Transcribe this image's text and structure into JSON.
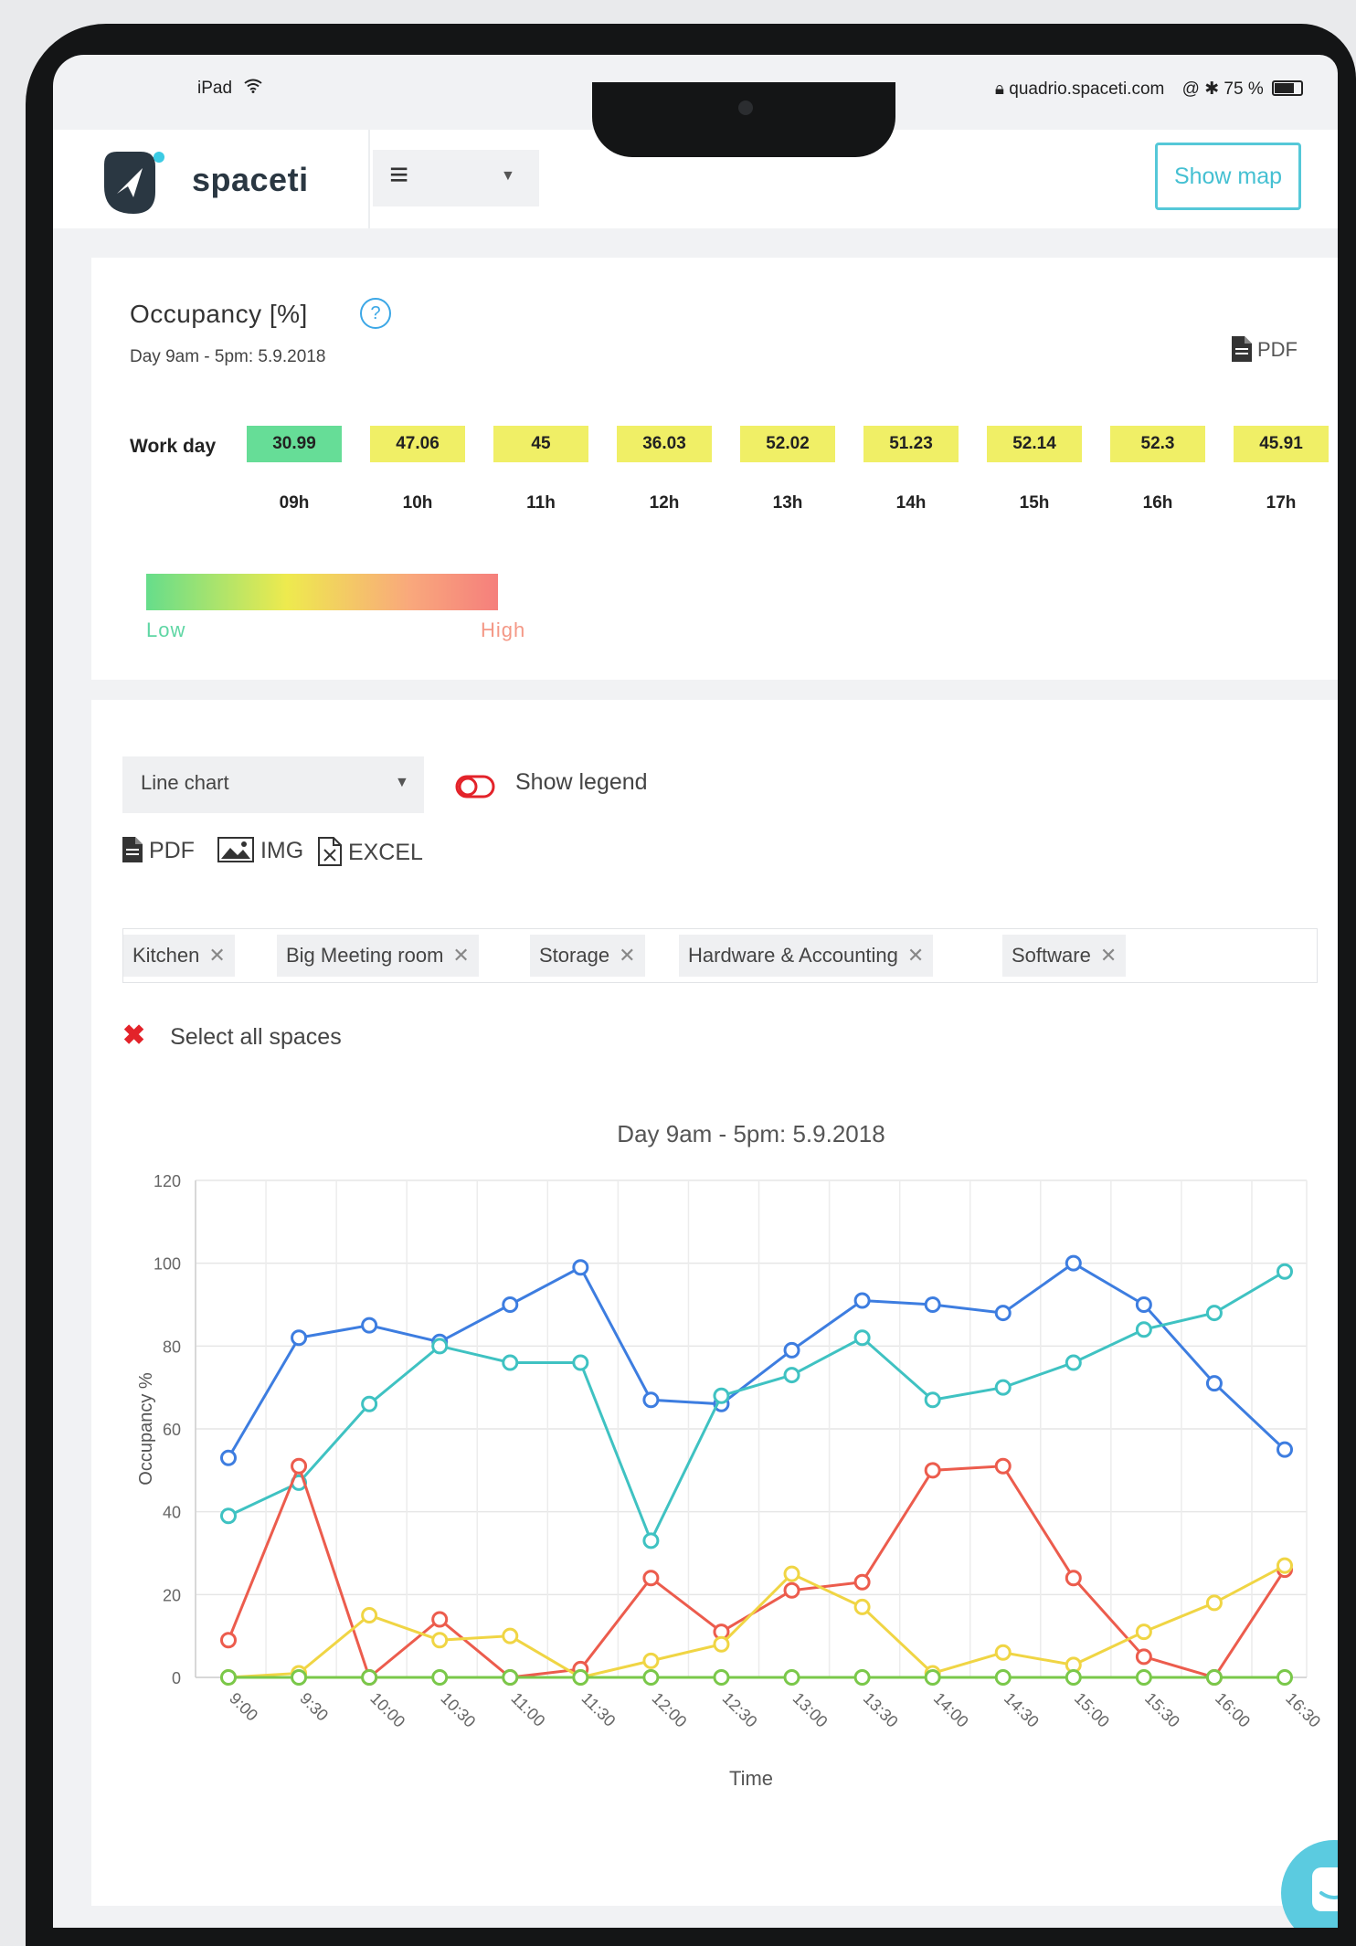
{
  "status_bar": {
    "device": "iPad",
    "url": "quadrio.spaceti.com",
    "battery": "75 %"
  },
  "header": {
    "logo_text": "spaceti",
    "menu_icon": "hamburger-icon",
    "show_map_label": "Show map"
  },
  "occupancy": {
    "title": "Occupancy [%]",
    "subtitle": "Day 9am - 5pm: 5.9.2018",
    "pdf_label": "PDF",
    "row_label": "Work day",
    "cells": [
      {
        "hour": "09h",
        "value": "30.99",
        "color": "#66dd97"
      },
      {
        "hour": "10h",
        "value": "47.06",
        "color": "#f0ef66"
      },
      {
        "hour": "11h",
        "value": "45",
        "color": "#f0ef66"
      },
      {
        "hour": "12h",
        "value": "36.03",
        "color": "#f0ef66"
      },
      {
        "hour": "13h",
        "value": "52.02",
        "color": "#f0ef66"
      },
      {
        "hour": "14h",
        "value": "51.23",
        "color": "#f0ef66"
      },
      {
        "hour": "15h",
        "value": "52.14",
        "color": "#f0ef66"
      },
      {
        "hour": "16h",
        "value": "52.3",
        "color": "#f0ef66"
      },
      {
        "hour": "17h",
        "value": "45.91",
        "color": "#f0ef66"
      }
    ],
    "scale_low": "Low",
    "scale_high": "High"
  },
  "controls": {
    "chart_type": "Line chart",
    "show_legend": "Show legend",
    "export_pdf": "PDF",
    "export_img": "IMG",
    "export_excel": "EXCEL",
    "tags": [
      "Kitchen",
      "Big Meeting room",
      "Storage",
      "Hardware & Accounting",
      "Software"
    ],
    "tag_close": "✕",
    "select_all": "Select all spaces"
  },
  "chart_data": {
    "type": "line",
    "title": "Day 9am - 5pm: 5.9.2018",
    "xlabel": "Time",
    "ylabel": "Occupancy %",
    "ylim": [
      0,
      120
    ],
    "yticks": [
      0,
      20,
      40,
      60,
      80,
      100,
      120
    ],
    "grid": true,
    "x": [
      "9:00",
      "9:30",
      "10:00",
      "10:30",
      "11:00",
      "11:30",
      "12:00",
      "12:30",
      "13:00",
      "13:30",
      "14:00",
      "14:30",
      "15:00",
      "15:30",
      "16:00",
      "16:30"
    ],
    "series": [
      {
        "color": "#3d7de0",
        "values": [
          53,
          82,
          85,
          81,
          90,
          99,
          67,
          66,
          79,
          91,
          90,
          88,
          100,
          90,
          71,
          55
        ]
      },
      {
        "color": "#3fc2c2",
        "values": [
          39,
          47,
          66,
          80,
          76,
          76,
          33,
          68,
          73,
          82,
          67,
          70,
          76,
          84,
          88,
          98
        ]
      },
      {
        "color": "#ec5c4d",
        "values": [
          9,
          51,
          0,
          14,
          0,
          2,
          24,
          11,
          21,
          23,
          50,
          51,
          24,
          5,
          0,
          26
        ]
      },
      {
        "color": "#f0d544",
        "values": [
          0,
          1,
          15,
          9,
          10,
          0,
          4,
          8,
          25,
          17,
          1,
          6,
          3,
          11,
          18,
          27
        ]
      },
      {
        "color": "#7ac84a",
        "values": [
          0,
          0,
          0,
          0,
          0,
          0,
          0,
          0,
          0,
          0,
          0,
          0,
          0,
          0,
          0,
          0
        ]
      }
    ]
  }
}
